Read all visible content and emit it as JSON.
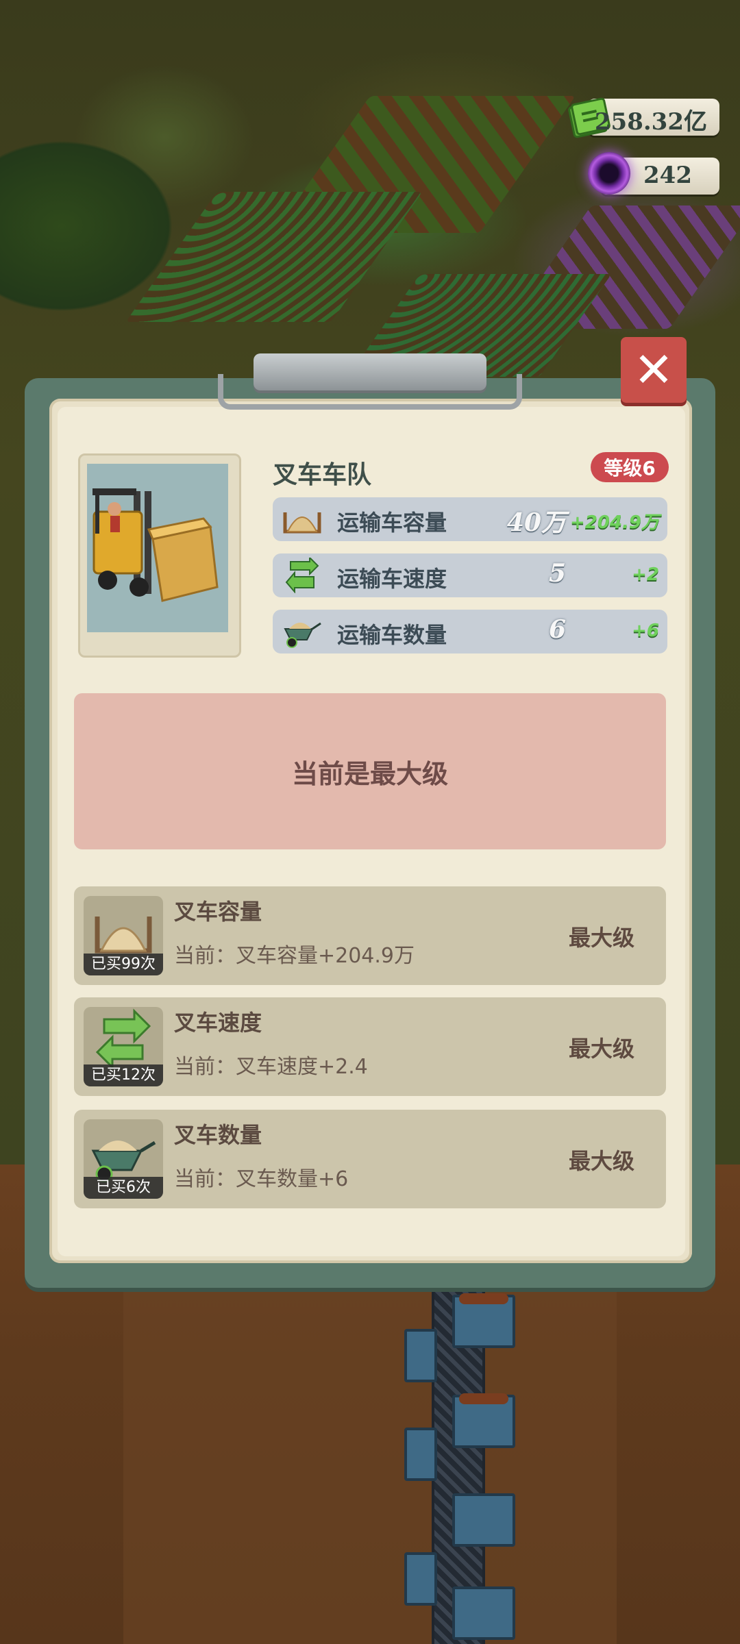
{
  "hud": {
    "cash_value": "258.32亿",
    "gem_value": "242",
    "cash_icon": "cash-stack-icon",
    "gem_icon": "purple-orb-icon"
  },
  "panel": {
    "close_label": "✕",
    "title": "叉车车队",
    "level_badge": "等级6",
    "stats": [
      {
        "icon": "sand-pile-icon",
        "label": "运输车容量",
        "value": "40万",
        "bonus": "+204.9万"
      },
      {
        "icon": "swap-arrows-icon",
        "label": "运输车速度",
        "value": "5",
        "bonus": "+2"
      },
      {
        "icon": "wheelbarrow-icon",
        "label": "运输车数量",
        "value": "6",
        "bonus": "+6"
      }
    ],
    "max_banner": "当前是最大级",
    "upgrades": [
      {
        "icon": "sand-pile-icon",
        "bought": "已买99次",
        "name": "叉车容量",
        "current": "当前：叉车容量+204.9万",
        "state": "最大级"
      },
      {
        "icon": "swap-arrows-icon",
        "bought": "已买12次",
        "name": "叉车速度",
        "current": "当前：叉车速度+2.4",
        "state": "最大级"
      },
      {
        "icon": "wheelbarrow-icon",
        "bought": "已买6次",
        "name": "叉车数量",
        "current": "当前：叉车数量+6",
        "state": "最大级"
      }
    ]
  },
  "colors": {
    "close_red": "#c8504a",
    "level_red": "#cc4a4f",
    "bonus_green": "#6fd15c",
    "max_box": "#e3b9ad"
  }
}
